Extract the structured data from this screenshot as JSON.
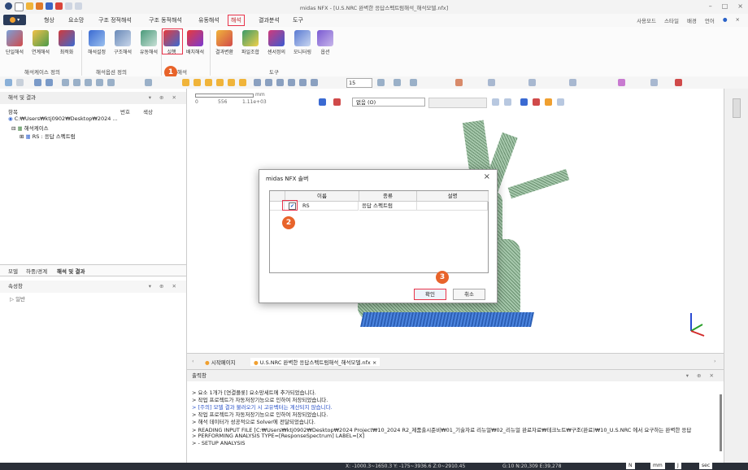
{
  "window": {
    "title": "midas NFX - [U.S.NRC 완벽한 응답스펙트럼해석_해석모델.nfx]"
  },
  "menu": {
    "app_label": "",
    "items": [
      "형상",
      "요소망",
      "구조 정적해석",
      "구조 동적해석",
      "유동해석",
      "해석",
      "결과분석",
      "도구"
    ],
    "right": [
      "사용모드",
      "스타일",
      "배경",
      "언어"
    ]
  },
  "ribbon": {
    "buttons": [
      "단일해석",
      "연계해석",
      "최적화",
      "해석설정",
      "구조해석",
      "유동해석",
      "실행",
      "배치해석",
      "결과변환",
      "파일조합",
      "센서정의",
      "모니터링",
      "옵션"
    ],
    "groups": [
      "해석케이스 정의",
      "해석옵션 정의",
      "해석",
      "도구"
    ]
  },
  "badges": {
    "one": "1",
    "two": "2",
    "three": "3"
  },
  "toolbar": {
    "zoom_value": "15"
  },
  "left_panel": {
    "title": "해석 및 결과",
    "col_item": "항목",
    "col_num": "번호",
    "col_color": "색상",
    "path": "C:₩Users₩ktj0902₩Desktop₩2024 ...",
    "case_folder": "해석케이스",
    "case_item": "RS : 응답 스펙트럼",
    "tabs": [
      "모델",
      "하중/경계",
      "해석 및 결과"
    ],
    "props_title": "속성창",
    "props_item": "일반"
  },
  "viewport": {
    "scale_left": "0",
    "scale_mid": "556",
    "scale_right": "1.11e+03",
    "scale_unit": "mm",
    "display_combo": "없음 (O)"
  },
  "dialog": {
    "title": "midas NFX 솔버",
    "columns": [
      "이름",
      "종류",
      "설명"
    ],
    "row": {
      "name": "RS",
      "type": "응답 스펙트럼",
      "desc": ""
    },
    "ok": "확인",
    "cancel": "취소"
  },
  "doc_tabs": {
    "start": "시작페이지",
    "doc": "U.S.NRC 완벽한 응답스펙트럼해석_해석모델.nfx"
  },
  "output": {
    "title": "출력창",
    "lines": [
      "> 요소 1개가 [연결플롯] 요소망세트에 추가되었습니다.",
      "> 작업 프로젝트가 자동저장기능으로 인하여 저장되었습니다.",
      "> [주의] 모델 결과 불러오기 시 고유벡터는 계산되지 않습니다.",
      "> 작업 프로젝트가 자동저장기능으로 인하여 저장되었습니다.",
      "> 해석 데이터가 성공적으로 Solver에 전달되었습니다.",
      "> READING INPUT FILE [C:₩Users₩ktj0902₩Desktop₩2024 Project₩10_2024 R2_제품출시준비₩01_기술자료 리뉴얼₩02_리뉴얼 완료자료₩테크노트₩구조(완료)₩10_U.S.NRC 에서 요구하는 완벽한 응답",
      "> PERFORMING ANALYSIS TYPE=[ResponseSpectrum] LABEL=[X]",
      "> - SETUP ANALYSIS"
    ]
  },
  "status": {
    "coords": "X: -1000.3~1650.3 Y: -175~3936.6 Z:0~2910.45",
    "grid": "G:10 N:20,309 E:39,278",
    "sel1": "N",
    "sel2": "mm",
    "sel3": "J",
    "sel4": "sec"
  }
}
